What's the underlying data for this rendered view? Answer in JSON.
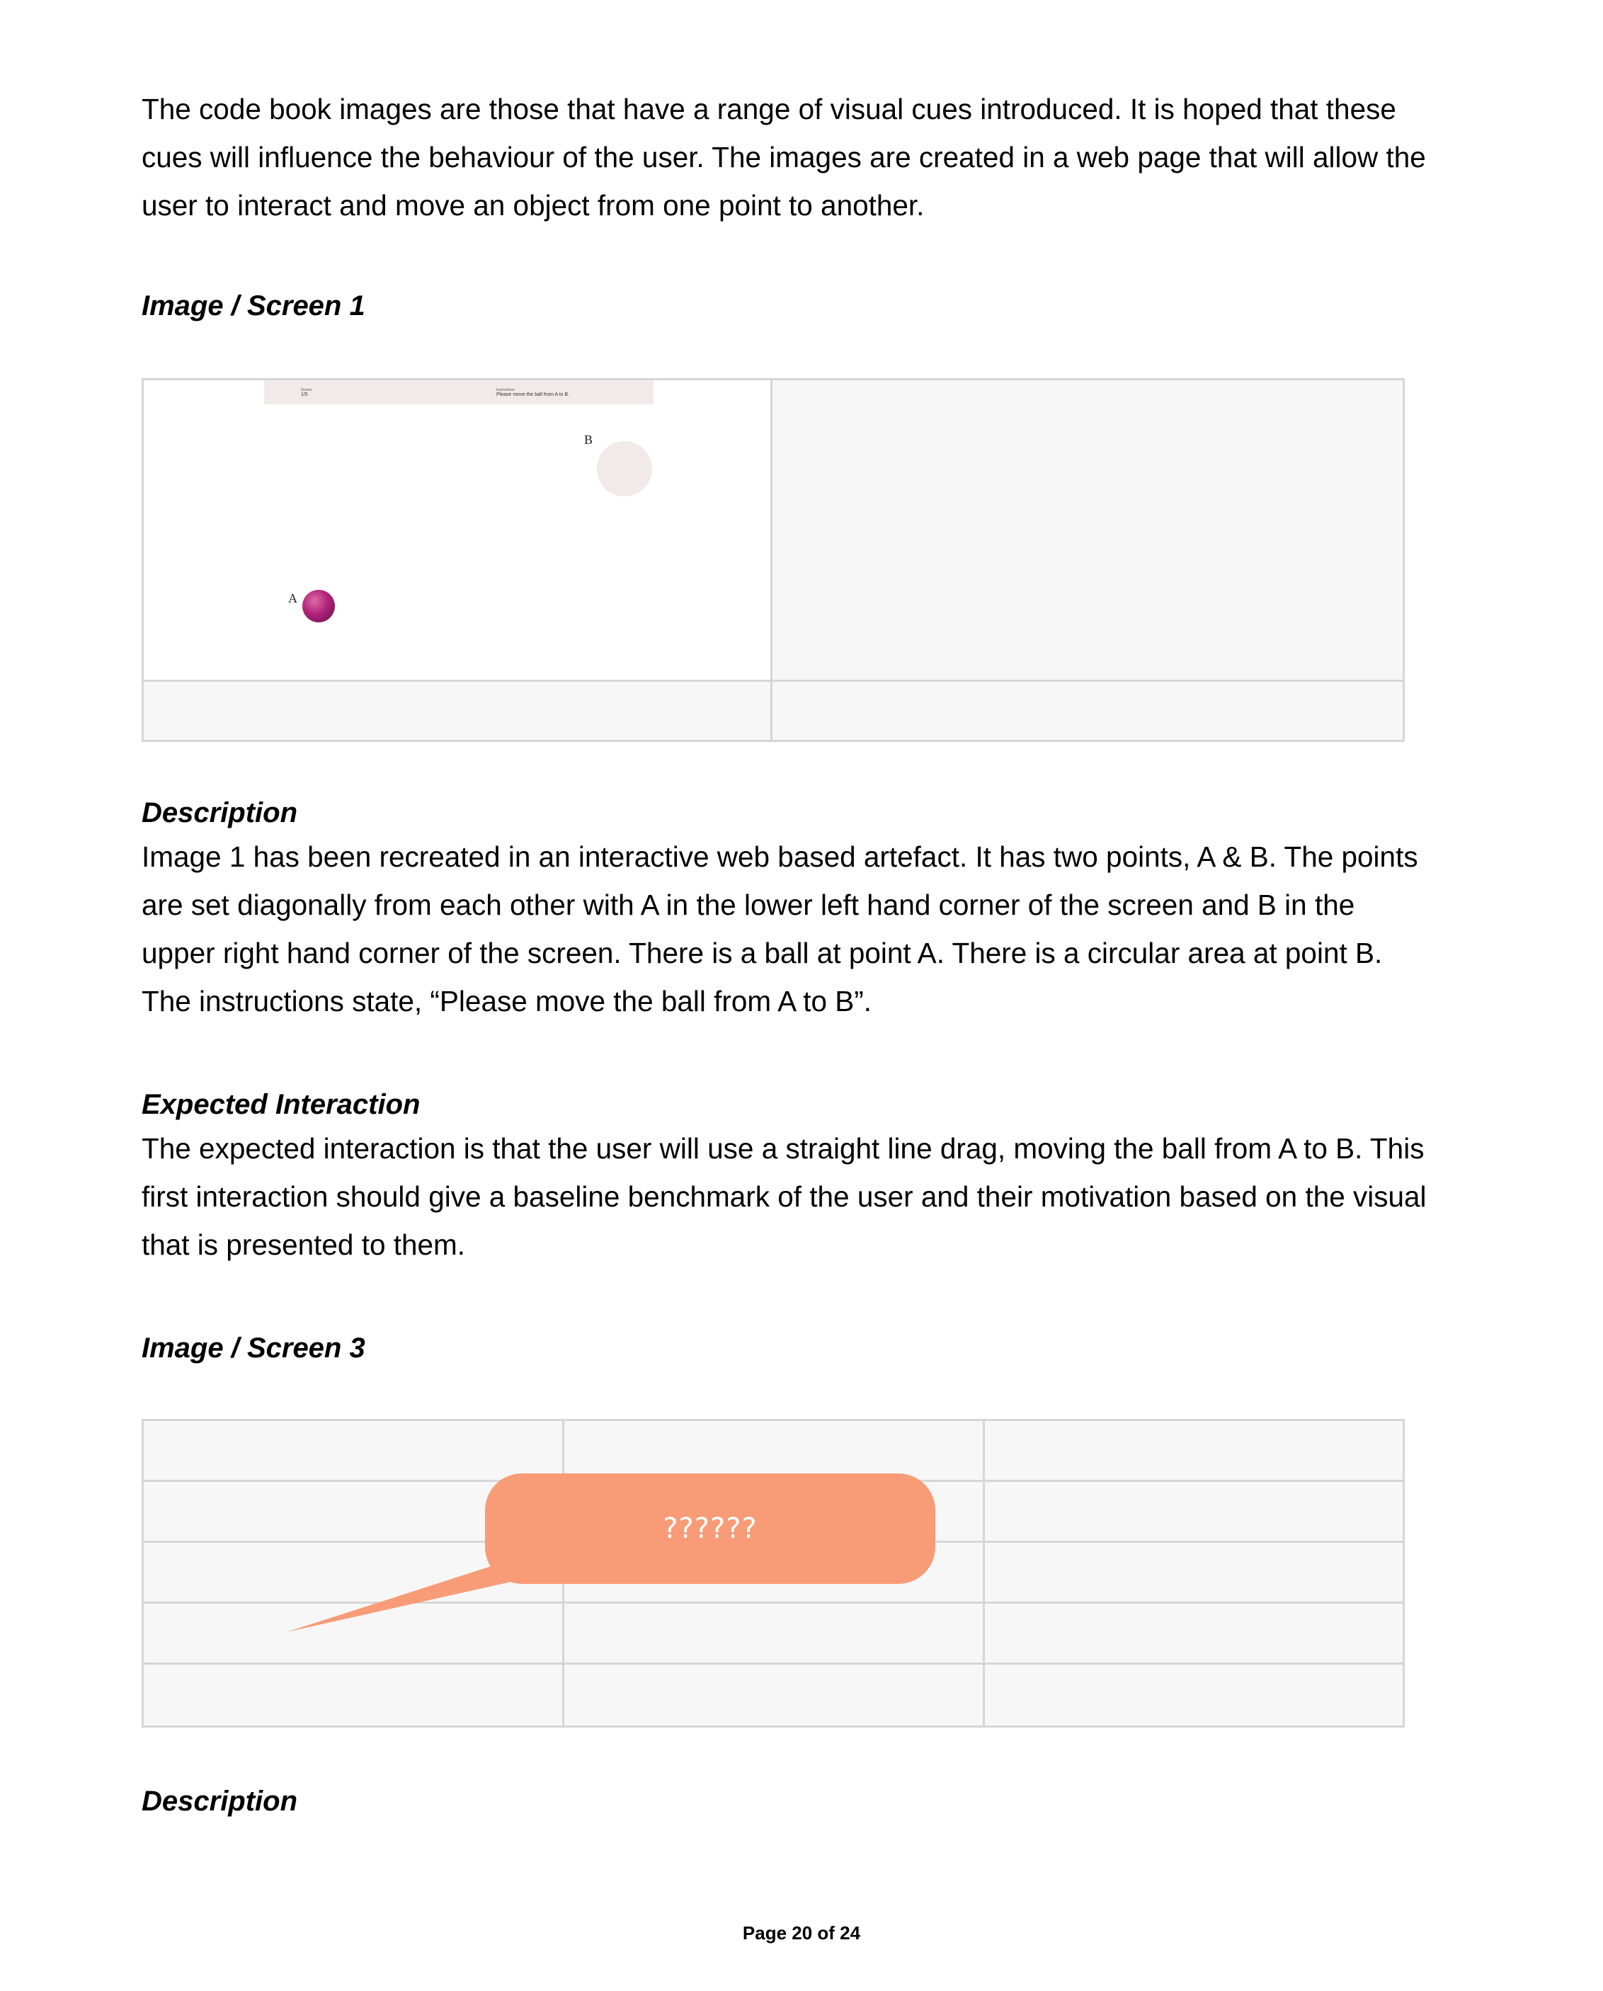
{
  "intro_paragraph": "The code book images are those that have a range of visual cues introduced. It is hoped that these cues will influence the behaviour of the user. The images are created in a web page that will allow the user to interact and move an object from one point to another.",
  "screen1": {
    "heading": "Image / Screen 1",
    "mockup": {
      "screen_label": "Screen",
      "screen_value": "1/5",
      "instructions_label": "Instructions",
      "instructions_value": "Please move the ball from A to B.",
      "point_a": "A",
      "point_b": "B",
      "ball_color": "#b0237a",
      "target_color": "#f1eae8"
    },
    "description_heading": "Description",
    "description": "Image 1 has been recreated in an interactive web based artefact. It has two points, A & B. The points are set diagonally from each other with A in the lower left hand corner of the screen and B in the upper right hand corner of the screen. There is a ball at point A. There is a circular area at point B. The instructions state, “Please move the ball from A to B”.",
    "interaction_heading": "Expected Interaction",
    "interaction": "The expected interaction is that the user will use a straight line drag, moving the ball from A to B. This first interaction should give a baseline benchmark of the user and their motivation based on the visual that is presented to them."
  },
  "screen3": {
    "heading": "Image / Screen 3",
    "bubble_text": "??????",
    "bubble_color": "#f79c77",
    "description_heading": "Description"
  },
  "footer": "Page 20 of 24"
}
